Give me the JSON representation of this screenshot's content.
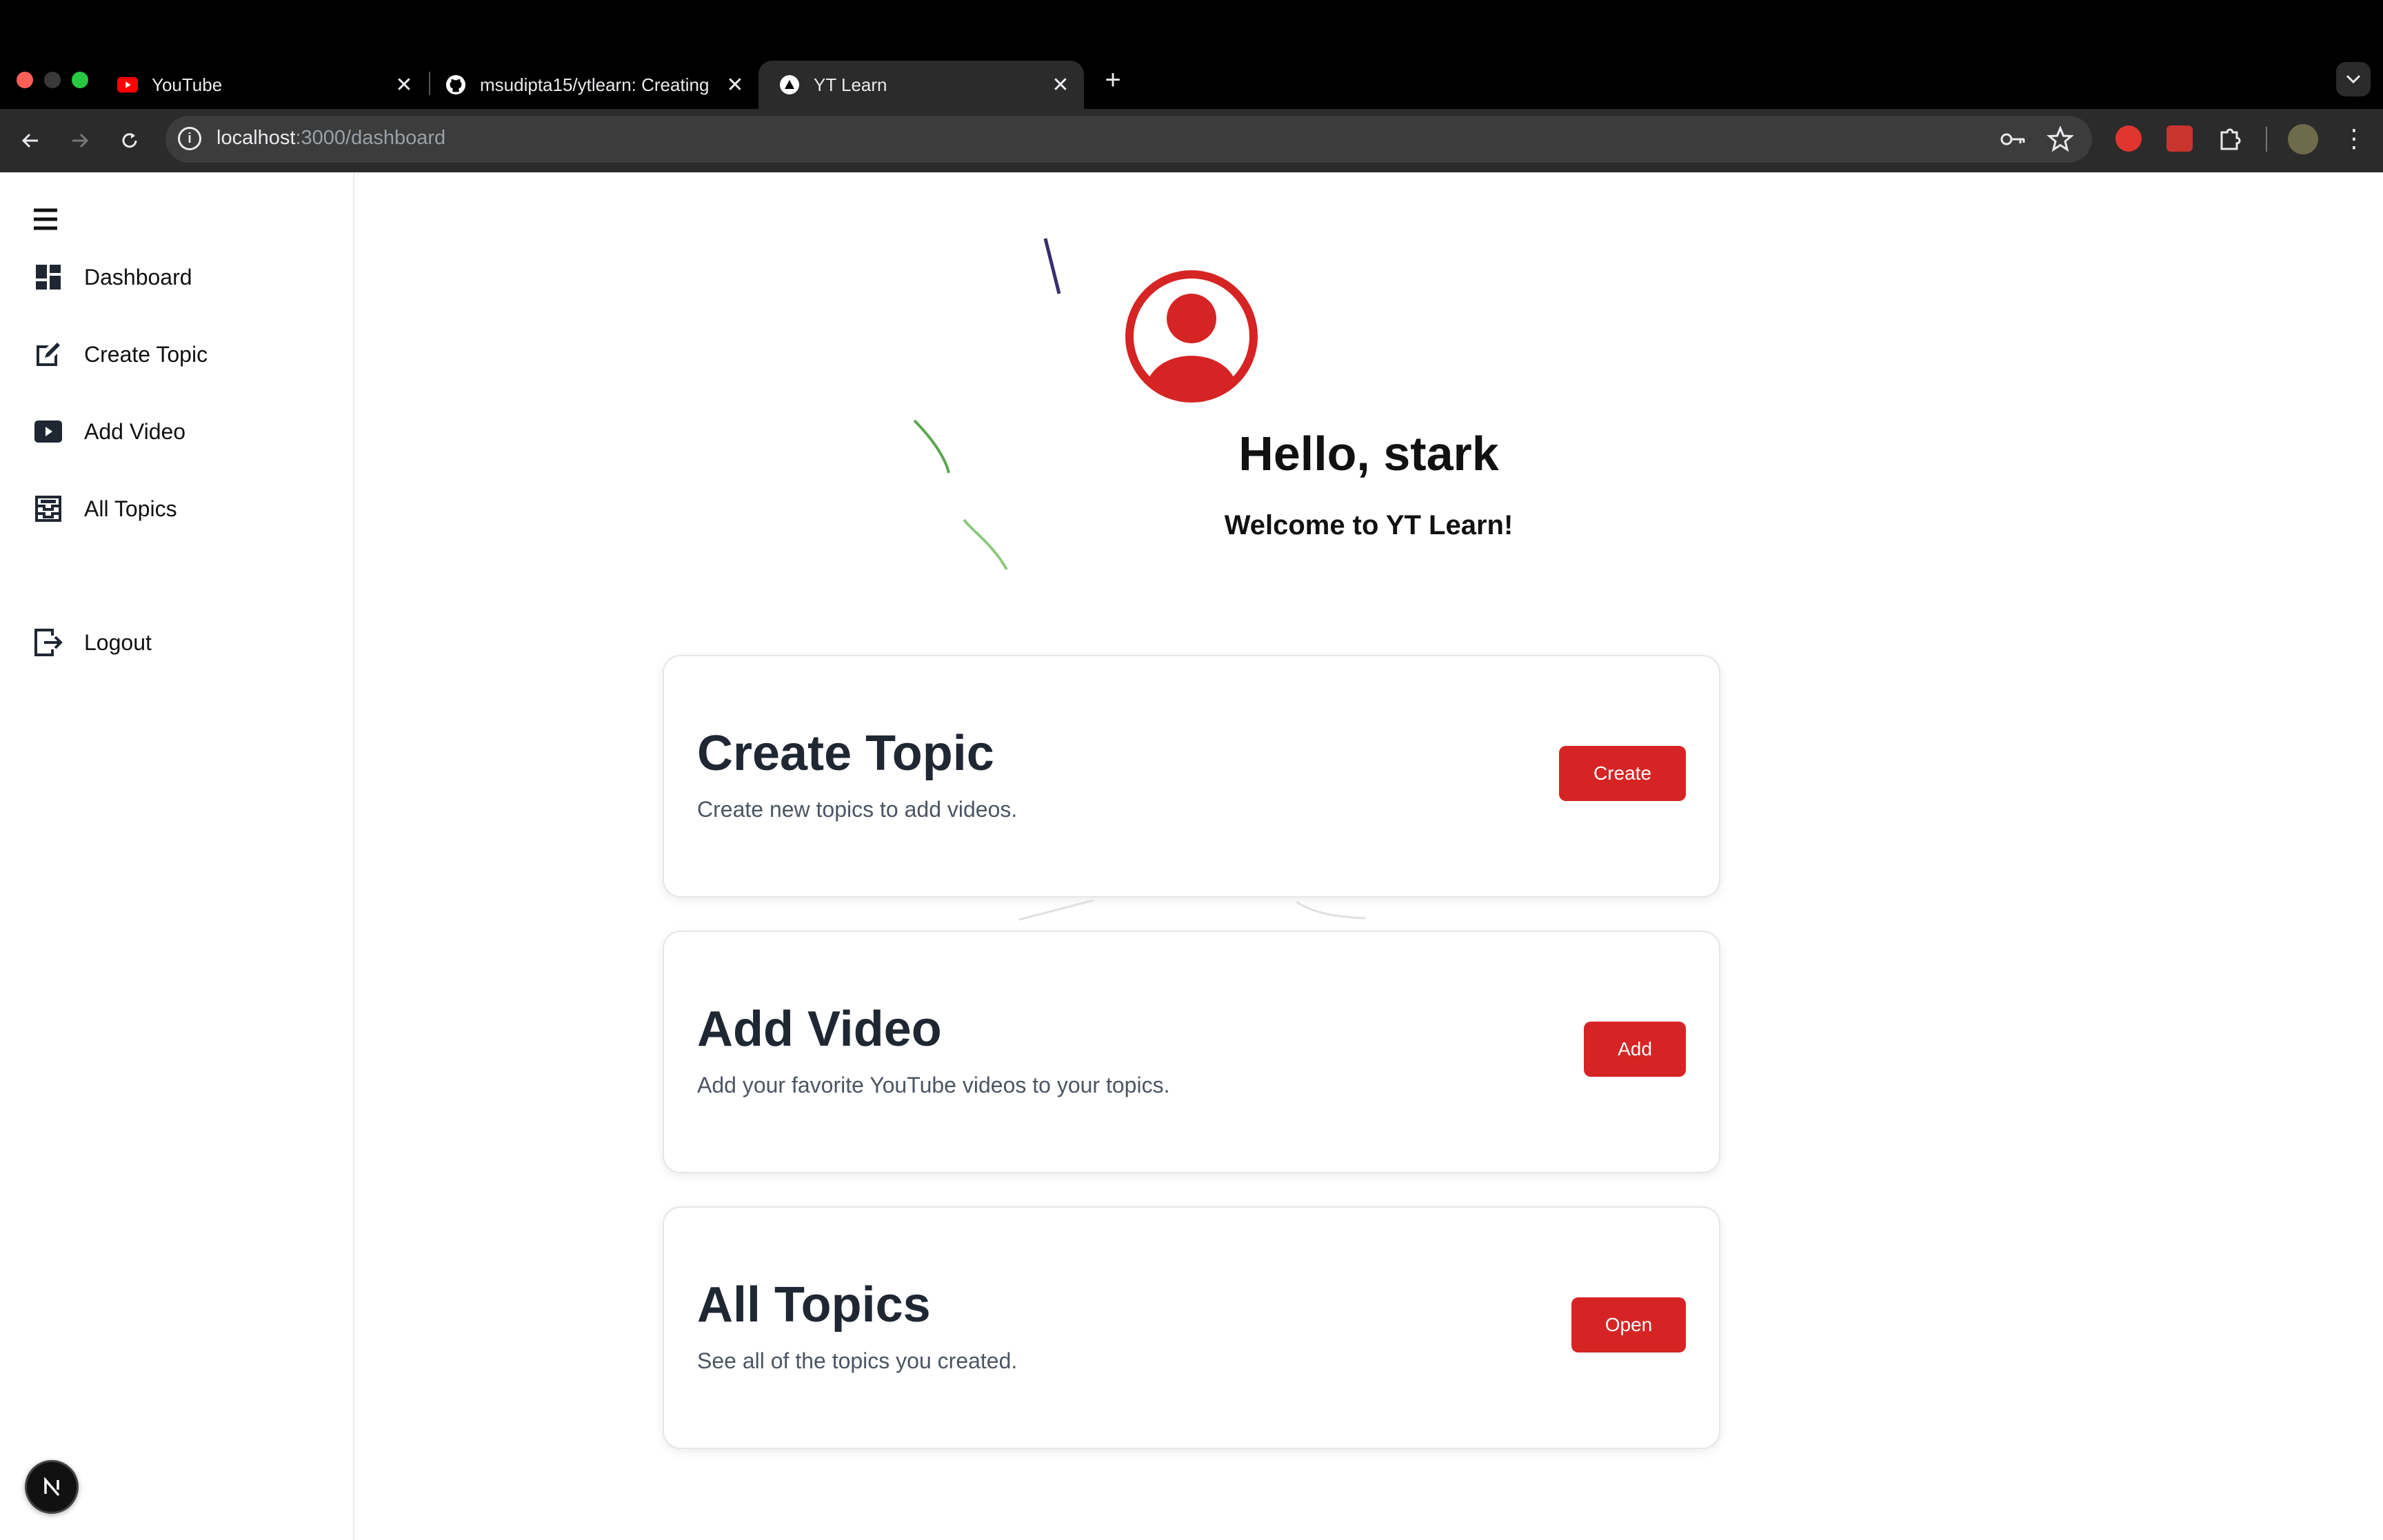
{
  "browser": {
    "tabs": [
      {
        "title": "YouTube",
        "favicon": "youtube-icon"
      },
      {
        "title": "msudipta15/ytlearn: Creating",
        "favicon": "github-icon"
      },
      {
        "title": "YT Learn",
        "favicon": "nextjs-icon"
      }
    ],
    "url_host": "localhost",
    "url_rest": ":3000/dashboard"
  },
  "sidebar": {
    "items": [
      {
        "label": "Dashboard",
        "icon": "dashboard-icon"
      },
      {
        "label": "Create Topic",
        "icon": "edit-icon"
      },
      {
        "label": "Add Video",
        "icon": "video-icon"
      },
      {
        "label": "All Topics",
        "icon": "inbox-icon"
      }
    ],
    "logout_label": "Logout"
  },
  "main": {
    "greeting": "Hello, stark",
    "welcome": "Welcome to YT Learn!",
    "cards": [
      {
        "title": "Create Topic",
        "description": "Create new topics to add videos.",
        "button": "Create"
      },
      {
        "title": "Add Video",
        "description": "Add your favorite YouTube videos to your topics.",
        "button": "Add"
      },
      {
        "title": "All Topics",
        "description": "See all of the topics you created.",
        "button": "Open"
      }
    ]
  },
  "colors": {
    "accent": "#d62424",
    "heading": "#1f2733"
  }
}
